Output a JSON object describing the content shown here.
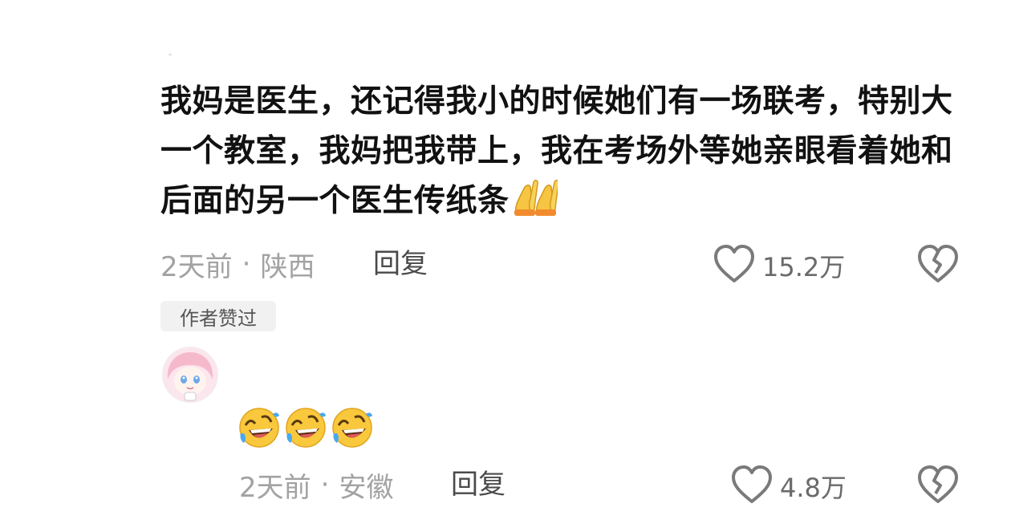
{
  "comment": {
    "text": "我妈是医生，还记得我小的时候她们有一场联考，特别大一个教室，我妈把我带上，我在考场外等她亲眼看着她和后面的另一个医生传纸条",
    "emojis": [
      "folded-hands",
      "folded-hands"
    ],
    "time": "2天前",
    "separator": "·",
    "location": "陕西",
    "reply_label": "回复",
    "like_count": "15.2万",
    "badge": "作者赞过"
  },
  "reply": {
    "emojis": [
      "rofl",
      "rofl",
      "rofl"
    ],
    "time": "2天前",
    "separator": "·",
    "location": "安徽",
    "reply_label": "回复",
    "like_count": "4.8万"
  },
  "icons": {
    "like": "heart-outline-icon",
    "dislike": "broken-heart-icon",
    "pray": "folded-hands-emoji",
    "laugh": "rolling-on-floor-laughing-emoji"
  },
  "colors": {
    "text": "#111111",
    "meta": "#a2a2a2",
    "reply": "#4a4a4a",
    "icon": "#7a7a7a",
    "badge_bg": "#f1f1f1"
  }
}
